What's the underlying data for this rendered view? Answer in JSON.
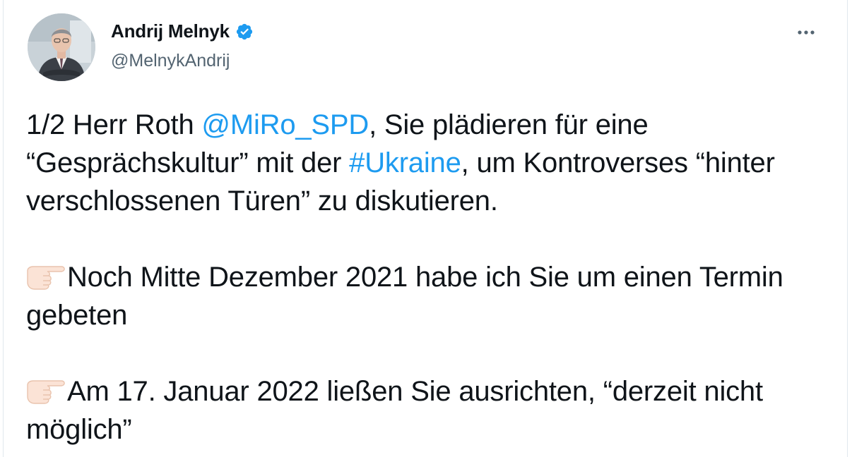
{
  "author": {
    "display_name": "Andrij Melnyk",
    "handle": "@MelnykAndrij",
    "verified_icon": "verified-badge-icon",
    "avatar_icon": "avatar"
  },
  "menu": {
    "more_icon": "more-options-icon"
  },
  "tweet": {
    "p1": {
      "t1": "1/2 Herr Roth ",
      "mention": "@MiRo_SPD",
      "t2": ", Sie plädieren für eine “Gesprächskultur” mit der ",
      "hashtag": "#Ukraine",
      "t3": ", um Kontroverses “hinter verschlossenen Türen” zu diskutieren."
    },
    "p2": {
      "emoji": "pointing-right-emoji",
      "text": "Noch Mitte Dezember 2021 habe ich Sie um einen Termin gebeten"
    },
    "p3": {
      "emoji": "pointing-right-emoji",
      "text": "Am 17. Januar 2022 ließen Sie ausrichten, “derzeit nicht möglich”"
    }
  },
  "colors": {
    "link": "#1d9bf0",
    "text": "#0f1419",
    "secondary": "#536471",
    "border": "#e1e8ed"
  }
}
